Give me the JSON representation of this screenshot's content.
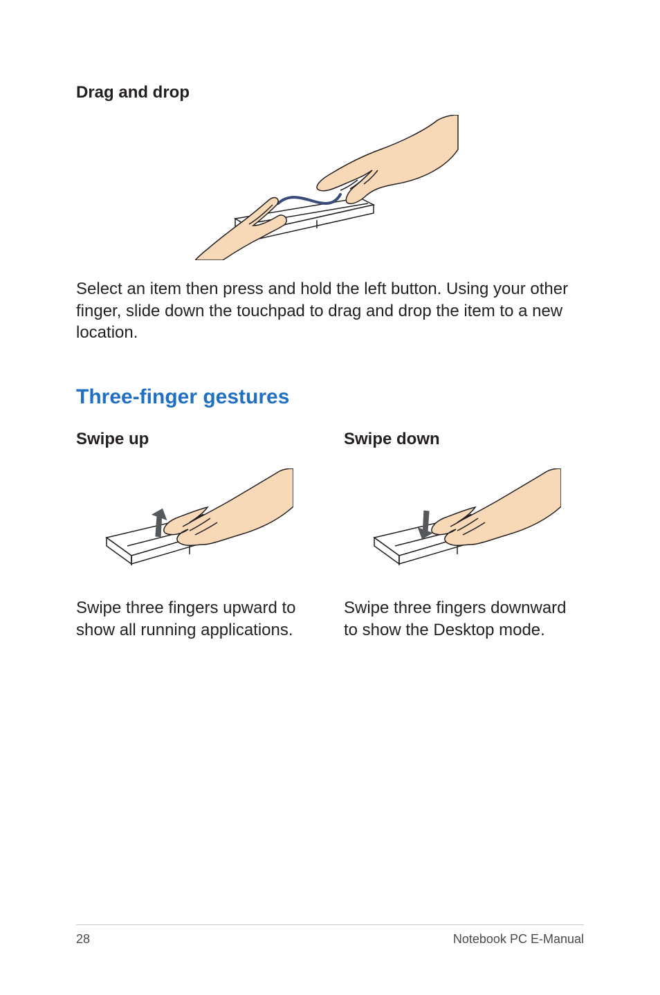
{
  "drag_drop": {
    "heading": "Drag and drop",
    "description": "Select an item then press and hold the left button. Using your other finger, slide down the touchpad to drag and drop the item to a new location."
  },
  "section_title": "Three-finger gestures",
  "swipe_up": {
    "heading": "Swipe up",
    "description": "Swipe three fingers upward to show all running applications."
  },
  "swipe_down": {
    "heading": "Swipe down",
    "description": "Swipe three fingers downward to show the Desktop mode."
  },
  "footer": {
    "page": "28",
    "label": "Notebook PC E-Manual"
  }
}
